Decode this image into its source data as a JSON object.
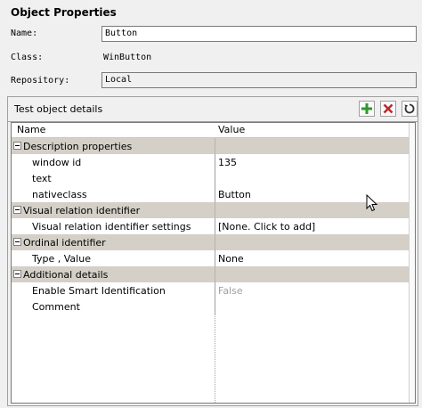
{
  "section_title": "Object Properties",
  "fields": {
    "name_label": "Name:",
    "name_value": "Button",
    "class_label": "Class:",
    "class_value": "WinButton",
    "repository_label": "Repository:",
    "repository_value": "Local"
  },
  "details": {
    "title": "Test object details",
    "toolbar": [
      {
        "icon": "plus-icon",
        "color": "#2a9a2a"
      },
      {
        "icon": "delete-icon",
        "color": "#c0282d"
      },
      {
        "icon": "refresh-icon",
        "color": "#333333"
      }
    ],
    "columns": {
      "name": "Name",
      "value": "Value"
    },
    "rows": [
      {
        "type": "category",
        "name": "Description properties",
        "value": ""
      },
      {
        "type": "property",
        "name": "window id",
        "value": "135"
      },
      {
        "type": "property",
        "name": "text",
        "value": ""
      },
      {
        "type": "property",
        "name": "nativeclass",
        "value": "Button"
      },
      {
        "type": "category",
        "name": "Visual relation identifier",
        "value": ""
      },
      {
        "type": "property",
        "name": "Visual relation identifier settings",
        "value": "[None. Click to add]"
      },
      {
        "type": "category",
        "name": "Ordinal identifier",
        "value": ""
      },
      {
        "type": "property",
        "name": "Type , Value",
        "value": "None"
      },
      {
        "type": "category",
        "name": "Additional details",
        "value": ""
      },
      {
        "type": "property",
        "name": "Enable Smart Identification",
        "value": "False",
        "disabled": true
      },
      {
        "type": "property",
        "name": "Comment",
        "value": ""
      }
    ]
  }
}
